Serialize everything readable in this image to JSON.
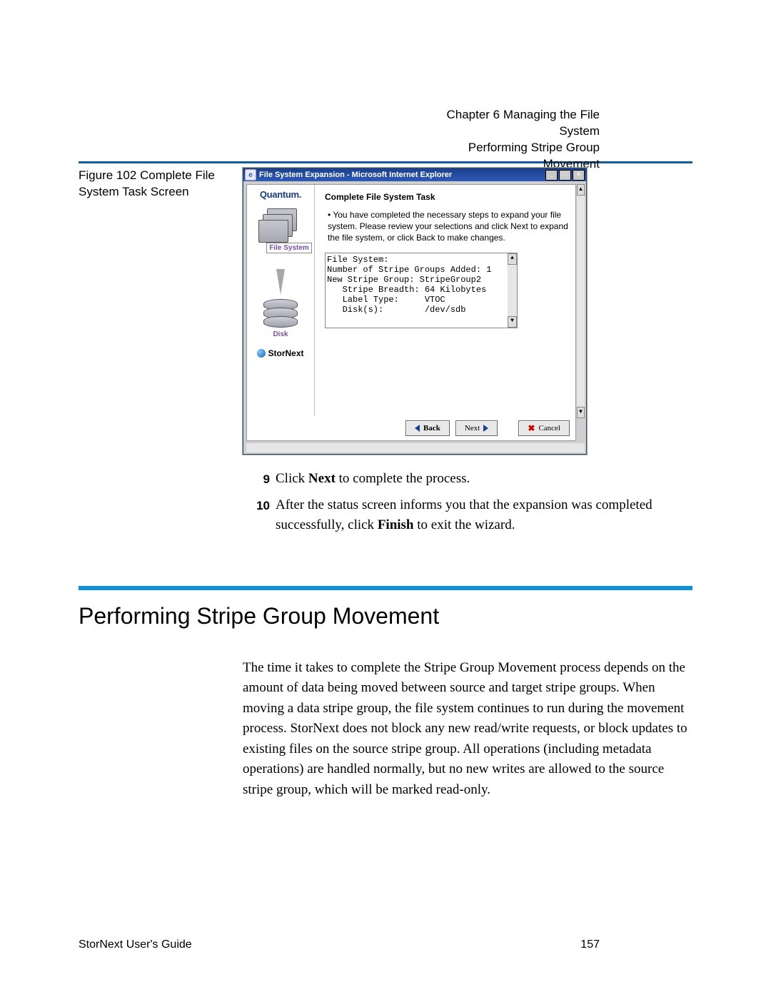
{
  "header": {
    "chapter": "Chapter 6  Managing the File System",
    "subtitle": "Performing Stripe Group Movement"
  },
  "figure": {
    "label": "Figure 102  Complete File System Task Screen"
  },
  "window": {
    "title": "File System Expansion - Microsoft Internet Explorer",
    "left": {
      "brand": "Quantum.",
      "fs_label": "File System",
      "disk_label": "Disk",
      "stornext": "StorNext"
    },
    "main": {
      "heading": "Complete File System Task",
      "bullet_lead": "•  You have completed the necessary steps to expand your file system. Please review your selections and click Next to expand the file system, or click Back to make changes.",
      "ta_lines": [
        "File System:",
        "Number of Stripe Groups Added: 1",
        "New Stripe Group: StripeGroup2",
        "   Stripe Breadth: 64 Kilobytes",
        "   Label Type:     VTOC",
        "   Disk(s):        /dev/sdb"
      ]
    },
    "buttons": {
      "back": "Back",
      "next": "Next",
      "cancel": "Cancel"
    }
  },
  "steps": [
    {
      "n": "9",
      "text_pre": "Click ",
      "b1": "Next",
      "text_post": " to complete the process."
    },
    {
      "n": "10",
      "text_pre": "After the status screen informs you that the expansion was completed successfully, click ",
      "b1": "Finish",
      "text_post": " to exit the wizard."
    }
  ],
  "section": {
    "heading": "Performing Stripe Group Movement",
    "body": "The time it takes to complete the Stripe Group Movement process depends on the amount of data being moved between source and target stripe groups. When moving a data stripe group, the file system continues to run during the movement process. StorNext does not block any new read/write requests, or block updates to existing files on the source stripe group. All operations (including metadata operations) are handled normally, but no new writes are allowed to the source stripe group, which will be marked read-only."
  },
  "footer": {
    "left": "StorNext User's Guide",
    "right": "157"
  }
}
